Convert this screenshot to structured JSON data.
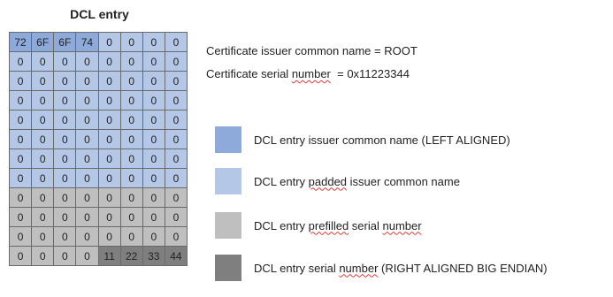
{
  "title": "DCL entry",
  "colors": {
    "issuer_cn": "#8eaadb",
    "padded_issuer_cn": "#b4c7e7",
    "prefilled_serial": "#bfbfbf",
    "serial_number": "#7f7f7f"
  },
  "grid": [
    [
      {
        "v": "72",
        "k": "issuer_cn"
      },
      {
        "v": "6F",
        "k": "issuer_cn"
      },
      {
        "v": "6F",
        "k": "issuer_cn"
      },
      {
        "v": "74",
        "k": "issuer_cn"
      },
      {
        "v": "0",
        "k": "padded_issuer_cn"
      },
      {
        "v": "0",
        "k": "padded_issuer_cn"
      },
      {
        "v": "0",
        "k": "padded_issuer_cn"
      },
      {
        "v": "0",
        "k": "padded_issuer_cn"
      }
    ],
    [
      {
        "v": "0",
        "k": "padded_issuer_cn"
      },
      {
        "v": "0",
        "k": "padded_issuer_cn"
      },
      {
        "v": "0",
        "k": "padded_issuer_cn"
      },
      {
        "v": "0",
        "k": "padded_issuer_cn"
      },
      {
        "v": "0",
        "k": "padded_issuer_cn"
      },
      {
        "v": "0",
        "k": "padded_issuer_cn"
      },
      {
        "v": "0",
        "k": "padded_issuer_cn"
      },
      {
        "v": "0",
        "k": "padded_issuer_cn"
      }
    ],
    [
      {
        "v": "0",
        "k": "padded_issuer_cn"
      },
      {
        "v": "0",
        "k": "padded_issuer_cn"
      },
      {
        "v": "0",
        "k": "padded_issuer_cn"
      },
      {
        "v": "0",
        "k": "padded_issuer_cn"
      },
      {
        "v": "0",
        "k": "padded_issuer_cn"
      },
      {
        "v": "0",
        "k": "padded_issuer_cn"
      },
      {
        "v": "0",
        "k": "padded_issuer_cn"
      },
      {
        "v": "0",
        "k": "padded_issuer_cn"
      }
    ],
    [
      {
        "v": "0",
        "k": "padded_issuer_cn"
      },
      {
        "v": "0",
        "k": "padded_issuer_cn"
      },
      {
        "v": "0",
        "k": "padded_issuer_cn"
      },
      {
        "v": "0",
        "k": "padded_issuer_cn"
      },
      {
        "v": "0",
        "k": "padded_issuer_cn"
      },
      {
        "v": "0",
        "k": "padded_issuer_cn"
      },
      {
        "v": "0",
        "k": "padded_issuer_cn"
      },
      {
        "v": "0",
        "k": "padded_issuer_cn"
      }
    ],
    [
      {
        "v": "0",
        "k": "padded_issuer_cn"
      },
      {
        "v": "0",
        "k": "padded_issuer_cn"
      },
      {
        "v": "0",
        "k": "padded_issuer_cn"
      },
      {
        "v": "0",
        "k": "padded_issuer_cn"
      },
      {
        "v": "0",
        "k": "padded_issuer_cn"
      },
      {
        "v": "0",
        "k": "padded_issuer_cn"
      },
      {
        "v": "0",
        "k": "padded_issuer_cn"
      },
      {
        "v": "0",
        "k": "padded_issuer_cn"
      }
    ],
    [
      {
        "v": "0",
        "k": "padded_issuer_cn"
      },
      {
        "v": "0",
        "k": "padded_issuer_cn"
      },
      {
        "v": "0",
        "k": "padded_issuer_cn"
      },
      {
        "v": "0",
        "k": "padded_issuer_cn"
      },
      {
        "v": "0",
        "k": "padded_issuer_cn"
      },
      {
        "v": "0",
        "k": "padded_issuer_cn"
      },
      {
        "v": "0",
        "k": "padded_issuer_cn"
      },
      {
        "v": "0",
        "k": "padded_issuer_cn"
      }
    ],
    [
      {
        "v": "0",
        "k": "padded_issuer_cn"
      },
      {
        "v": "0",
        "k": "padded_issuer_cn"
      },
      {
        "v": "0",
        "k": "padded_issuer_cn"
      },
      {
        "v": "0",
        "k": "padded_issuer_cn"
      },
      {
        "v": "0",
        "k": "padded_issuer_cn"
      },
      {
        "v": "0",
        "k": "padded_issuer_cn"
      },
      {
        "v": "0",
        "k": "padded_issuer_cn"
      },
      {
        "v": "0",
        "k": "padded_issuer_cn"
      }
    ],
    [
      {
        "v": "0",
        "k": "padded_issuer_cn"
      },
      {
        "v": "0",
        "k": "padded_issuer_cn"
      },
      {
        "v": "0",
        "k": "padded_issuer_cn"
      },
      {
        "v": "0",
        "k": "padded_issuer_cn"
      },
      {
        "v": "0",
        "k": "padded_issuer_cn"
      },
      {
        "v": "0",
        "k": "padded_issuer_cn"
      },
      {
        "v": "0",
        "k": "padded_issuer_cn"
      },
      {
        "v": "0",
        "k": "padded_issuer_cn"
      }
    ],
    [
      {
        "v": "0",
        "k": "prefilled_serial"
      },
      {
        "v": "0",
        "k": "prefilled_serial"
      },
      {
        "v": "0",
        "k": "prefilled_serial"
      },
      {
        "v": "0",
        "k": "prefilled_serial"
      },
      {
        "v": "0",
        "k": "prefilled_serial"
      },
      {
        "v": "0",
        "k": "prefilled_serial"
      },
      {
        "v": "0",
        "k": "prefilled_serial"
      },
      {
        "v": "0",
        "k": "prefilled_serial"
      }
    ],
    [
      {
        "v": "0",
        "k": "prefilled_serial"
      },
      {
        "v": "0",
        "k": "prefilled_serial"
      },
      {
        "v": "0",
        "k": "prefilled_serial"
      },
      {
        "v": "0",
        "k": "prefilled_serial"
      },
      {
        "v": "0",
        "k": "prefilled_serial"
      },
      {
        "v": "0",
        "k": "prefilled_serial"
      },
      {
        "v": "0",
        "k": "prefilled_serial"
      },
      {
        "v": "0",
        "k": "prefilled_serial"
      }
    ],
    [
      {
        "v": "0",
        "k": "prefilled_serial"
      },
      {
        "v": "0",
        "k": "prefilled_serial"
      },
      {
        "v": "0",
        "k": "prefilled_serial"
      },
      {
        "v": "0",
        "k": "prefilled_serial"
      },
      {
        "v": "0",
        "k": "prefilled_serial"
      },
      {
        "v": "0",
        "k": "prefilled_serial"
      },
      {
        "v": "0",
        "k": "prefilled_serial"
      },
      {
        "v": "0",
        "k": "prefilled_serial"
      }
    ],
    [
      {
        "v": "0",
        "k": "prefilled_serial"
      },
      {
        "v": "0",
        "k": "prefilled_serial"
      },
      {
        "v": "0",
        "k": "prefilled_serial"
      },
      {
        "v": "0",
        "k": "prefilled_serial"
      },
      {
        "v": "11",
        "k": "serial_number"
      },
      {
        "v": "22",
        "k": "serial_number"
      },
      {
        "v": "33",
        "k": "serial_number"
      },
      {
        "v": "44",
        "k": "serial_number"
      }
    ]
  ],
  "info": {
    "common_name_line": "Certificate issuer common name = ROOT",
    "serial_prefix": "Certificate serial ",
    "serial_word": "number",
    "serial_value": "  = 0x11223344"
  },
  "legend": [
    {
      "key": "issuer_cn",
      "label": [
        {
          "t": "DCL entry issuer common name (LEFT ALIGNED)"
        }
      ]
    },
    {
      "key": "padded_issuer_cn",
      "label": [
        {
          "t": "DCL entry "
        },
        {
          "t": "padded",
          "u": true
        },
        {
          "t": " issuer common name"
        }
      ]
    },
    {
      "key": "prefilled_serial",
      "label": [
        {
          "t": "DCL entry "
        },
        {
          "t": "prefilled",
          "u": true
        },
        {
          "t": " serial "
        },
        {
          "t": "number",
          "u": true
        }
      ]
    },
    {
      "key": "serial_number",
      "label": [
        {
          "t": "DCL entry serial "
        },
        {
          "t": "number",
          "u": true
        },
        {
          "t": " (RIGHT ALIGNED BIG ENDIAN)"
        }
      ]
    }
  ]
}
